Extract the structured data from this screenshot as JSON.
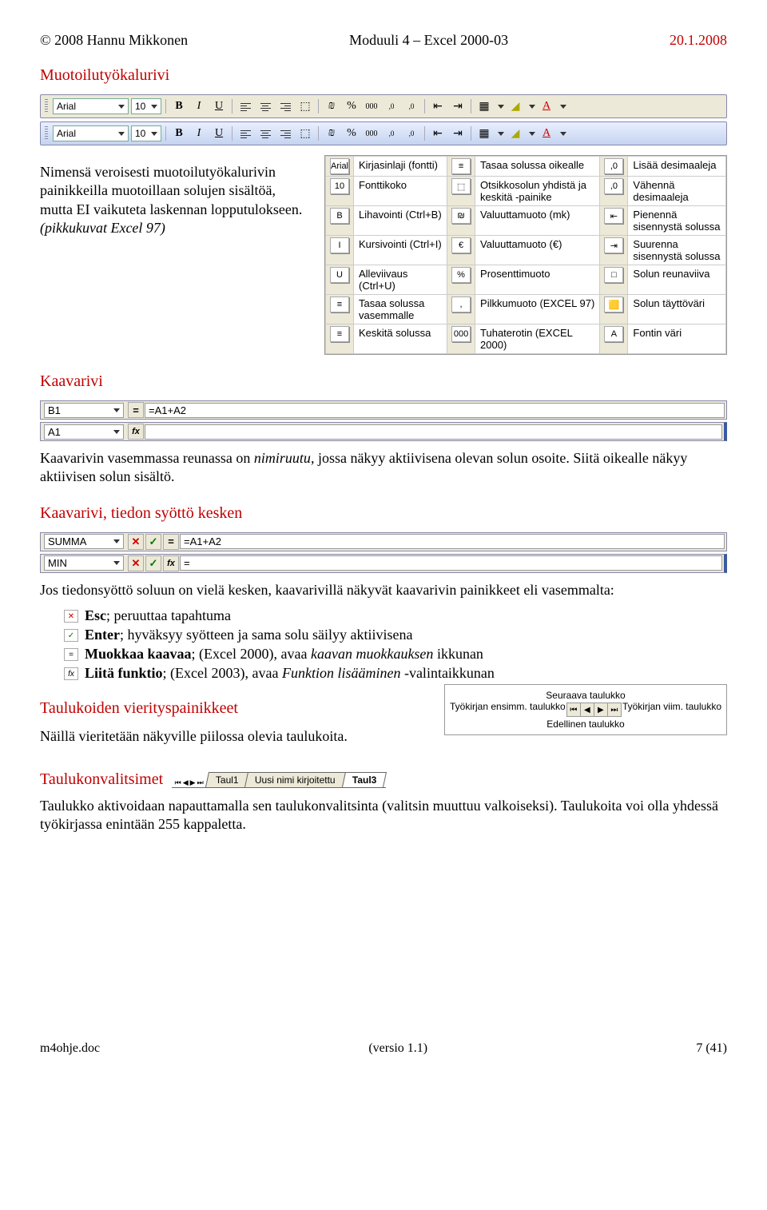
{
  "header": {
    "left": "© 2008 Hannu Mikkonen",
    "center": "Moduuli 4 – Excel 2000-03",
    "right": "20.1.2008"
  },
  "section1": {
    "title": "Muotoilutyökalurivi",
    "font_name": "Arial",
    "font_size": "10",
    "bold": "B",
    "italic": "I",
    "underline": "U",
    "currency_fmt": "%",
    "thousands": "000",
    "paragraph": "Nimensä veroisesti muotoilutyökalurivin painikkeilla muotoillaan solujen sisältöä, mutta EI vaikuteta laskennan lopputulokseen.",
    "paragraph2": "(pikkukuvat Excel 97)"
  },
  "icon_table": {
    "rows": [
      {
        "c1_icon": "Arial",
        "c1": "Kirjasinlaji (fontti)",
        "c2_icon": "≡",
        "c2": "Tasaa solussa oikealle",
        "c3_icon": ",0",
        "c3": "Lisää desimaaleja"
      },
      {
        "c1_icon": "10",
        "c1": "Fonttikoko",
        "c2_icon": "⬚",
        "c2": "Otsikkosolun yhdistä ja keskitä -painike",
        "c3_icon": ",0",
        "c3": "Vähennä desimaaleja"
      },
      {
        "c1_icon": "B",
        "c1": "Lihavointi (Ctrl+B)",
        "c2_icon": "₪",
        "c2": "Valuuttamuoto (mk)",
        "c3_icon": "⇤",
        "c3": "Pienennä sisennystä solussa"
      },
      {
        "c1_icon": "I",
        "c1": "Kursivointi (Ctrl+I)",
        "c2_icon": "€",
        "c2": "Valuuttamuoto (€)",
        "c3_icon": "⇥",
        "c3": "Suurenna sisennystä solussa"
      },
      {
        "c1_icon": "U",
        "c1": "Alleviivaus (Ctrl+U)",
        "c2_icon": "%",
        "c2": "Prosenttimuoto",
        "c3_icon": "□",
        "c3": "Solun reunaviiva"
      },
      {
        "c1_icon": "≡",
        "c1": "Tasaa solussa vasemmalle",
        "c2_icon": ",",
        "c2": "Pilkkumuoto (EXCEL 97)",
        "c3_icon": "🟨",
        "c3": "Solun täyttöväri"
      },
      {
        "c1_icon": "≡",
        "c1": "Keskitä solussa",
        "c2_icon": "000",
        "c2": "Tuhaterotin (EXCEL 2000)",
        "c3_icon": "A",
        "c3": "Fontin väri"
      }
    ]
  },
  "section2": {
    "title": "Kaavarivi",
    "namebox1": "B1",
    "formula1": "=A1+A2",
    "namebox2": "A1",
    "paragraph": "Kaavarivin vasemmassa reunassa on nimiruutu, jossa näkyy aktiivisena olevan solun osoite. Siitä oikealle näkyy aktiivisen solun sisältö."
  },
  "section3": {
    "title": "Kaavarivi, tiedon syöttö kesken",
    "namebox1": "SUMMA",
    "formula1": "=A1+A2",
    "namebox2": "MIN",
    "formula2": "=",
    "paragraph_intro": "Jos tiedonsyöttö soluun on vielä kesken, kaavarivillä näkyvät kaavarivin painikkeet eli vasemmalta:",
    "bullets": {
      "b1": "Esc; peruuttaa tapahtuma",
      "b1_bold": "Esc",
      "b2": "Enter; hyväksyy syötteen ja sama solu säilyy aktiivisena",
      "b2_bold": "Enter",
      "b3": "Muokkaa kaavaa; (Excel 2000), avaa kaavan muokkauksen ikkunan",
      "b3_bold": "Muokkaa kaavaa",
      "b4": "Liitä funktio; (Excel 2003), avaa Funktion lisääminen -valintaikkunan",
      "b4_bold": "Liitä funktio"
    }
  },
  "section4": {
    "title": "Taulukoiden vierityspainikkeet",
    "paragraph": "Näillä vieritetään näkyville piilossa olevia taulukoita.",
    "diagram": {
      "top_right": "Seuraava taulukko",
      "left": "Työkirjan ensimm. taulukko",
      "right": "Työkirjan viim. taulukko",
      "bottom": "Edellinen taulukko"
    }
  },
  "section5": {
    "title": "Taulukonvalitsimet",
    "tabs": [
      "Taul1",
      "Uusi nimi kirjoitettu",
      "Taul3"
    ],
    "paragraph": "Taulukko aktivoidaan napauttamalla sen taulukonvalitsinta (valitsin muuttuu valkoiseksi). Taulukoita voi olla yhdessä työkirjassa enintään 255 kappaletta."
  },
  "footer": {
    "left": "m4ohje.doc",
    "center": "(versio 1.1)",
    "right": "7 (41)"
  }
}
